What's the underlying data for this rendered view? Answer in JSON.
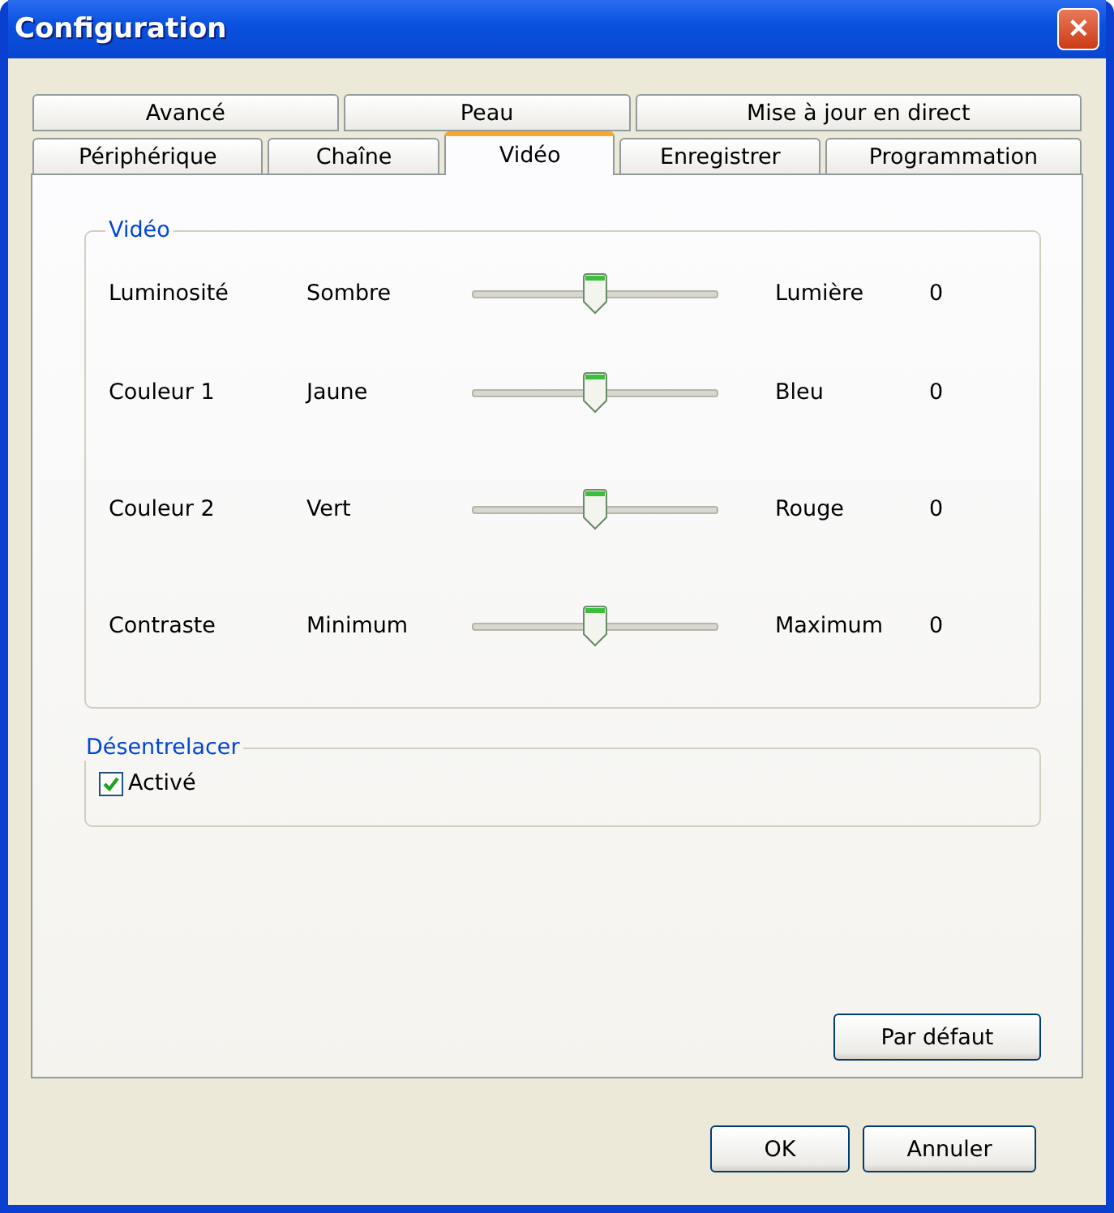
{
  "window": {
    "title": "Configuration",
    "close": "✕"
  },
  "tab_rows": [
    [
      {
        "label": "Avancé",
        "selected": false
      },
      {
        "label": "Peau",
        "selected": false
      },
      {
        "label": "Mise à jour en direct",
        "selected": false
      }
    ],
    [
      {
        "label": "Périphérique",
        "selected": false
      },
      {
        "label": "Chaîne",
        "selected": false
      },
      {
        "label": "Vidéo",
        "selected": true
      },
      {
        "label": "Enregistrer",
        "selected": false
      },
      {
        "label": "Programmation",
        "selected": false
      }
    ]
  ],
  "video_group": {
    "title": "Vidéo",
    "sliders": [
      {
        "name": "Luminosité",
        "min_label": "Sombre",
        "max_label": "Lumière",
        "level": 0.5,
        "reading": "0"
      },
      {
        "name": "Couleur 1",
        "min_label": "Jaune",
        "max_label": "Bleu",
        "level": 0.5,
        "reading": "0"
      },
      {
        "name": "Couleur 2",
        "min_label": "Vert",
        "max_label": "Rouge",
        "level": 0.5,
        "reading": "0"
      },
      {
        "name": "Contraste",
        "min_label": "Minimum",
        "max_label": "Maximum",
        "level": 0.5,
        "reading": "0"
      }
    ]
  },
  "deinterlace_group": {
    "title": "Désentrelacer",
    "checkbox": {
      "label": "Activé",
      "checked": true
    }
  },
  "default_button": "Par défaut",
  "buttons": [
    "OK",
    "Annuler"
  ]
}
